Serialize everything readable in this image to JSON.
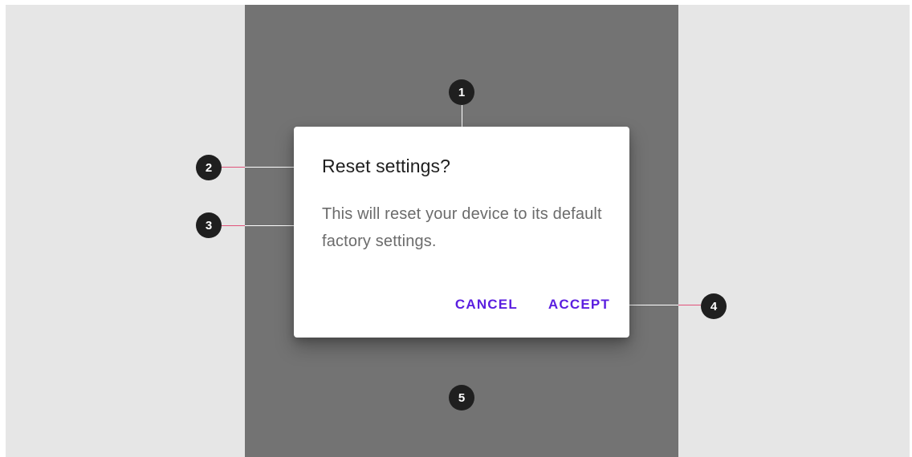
{
  "dialog": {
    "title": "Reset settings?",
    "body": "This will reset your device to its default factory settings.",
    "actions": [
      {
        "label": "CANCEL"
      },
      {
        "label": "ACCEPT"
      }
    ]
  },
  "callouts": [
    {
      "label": "1"
    },
    {
      "label": "2"
    },
    {
      "label": "3"
    },
    {
      "label": "4"
    },
    {
      "label": "5"
    }
  ],
  "colors": {
    "canvas": "#e6e6e6",
    "scrim": "#737373",
    "dialog_surface": "#ffffff",
    "title_text": "#1f1f1f",
    "body_text": "#6b6b6b",
    "action_text": "#5b1fe0",
    "badge_fill": "#1f1f1f",
    "leader_line_pink": "#e0527a",
    "leader_line_white": "#ffffff"
  }
}
